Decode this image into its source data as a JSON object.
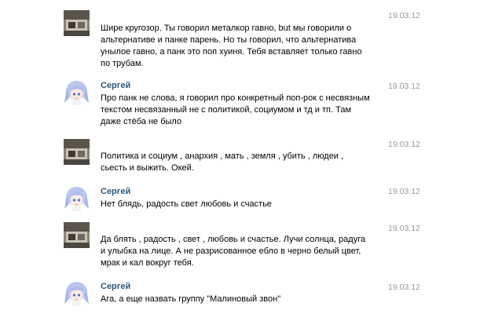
{
  "messages": [
    {
      "author": "",
      "date": "19.03.12",
      "avatar": "user-photo-avatar",
      "text": "Шире кругозор. Ты говорил металкор гавно, but мы говорили о альтернативе и панке парень. Но ты говорил, что альтернатива унылое гавно, а панк это поп хуиня. Тебя вставляет только гавно по трубам."
    },
    {
      "author": "Сергей",
      "date": "19.03.12",
      "avatar": "anime-girl-avatar",
      "text": "Про панк не слова, я говорил про конкретный поп-рок с несвязным текстом несвязанный не с политикой, социумом и тд и тп. Там даже стёба не было"
    },
    {
      "author": "",
      "date": "19.03.12",
      "avatar": "user-photo-avatar",
      "text": "Политика и социум , анархия , мать , земля , убить , людеи , сьесть и выжить. Окей."
    },
    {
      "author": "Сергей",
      "date": "19.03.12",
      "avatar": "anime-girl-avatar",
      "text": "Нет блядь, радость свет любовь и счастье"
    },
    {
      "author": "",
      "date": "19.03.12",
      "avatar": "user-photo-avatar",
      "text": "Да блять , радость , свет , любовь и счастье. Лучи солнца, радуга и улыбка на лице. А не разрисованное ебло в черно белый цвет, мрак и кал вокруг тебя."
    },
    {
      "author": "Сергей",
      "date": "19.03.12",
      "avatar": "anime-girl-avatar",
      "text": "Ага, а еще назвать группу \"Малиновый звон\""
    }
  ]
}
